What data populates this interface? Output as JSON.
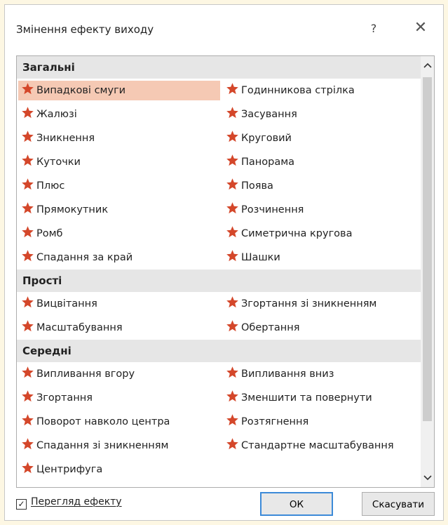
{
  "dialog": {
    "title": "Змінення ефекту виходу",
    "help_label": "?",
    "close_label": "✕"
  },
  "groups": [
    {
      "name": "Загальні",
      "rows": [
        [
          "Випадкові смуги",
          "Годинникова стрілка"
        ],
        [
          "Жалюзі",
          "Засування"
        ],
        [
          "Зникнення",
          "Круговий"
        ],
        [
          "Куточки",
          "Панорама"
        ],
        [
          "Плюс",
          "Поява"
        ],
        [
          "Прямокутник",
          "Розчинення"
        ],
        [
          "Ромб",
          "Симетрична кругова"
        ],
        [
          "Спадання за край",
          "Шашки"
        ]
      ]
    },
    {
      "name": "Прості",
      "rows": [
        [
          "Вицвітання",
          "Згортання зі зникненням"
        ],
        [
          "Масштабування",
          "Обертання"
        ]
      ]
    },
    {
      "name": "Середні",
      "rows": [
        [
          "Випливання вгору",
          "Випливання вниз"
        ],
        [
          "Згортання",
          "Зменшити та повернути"
        ],
        [
          "Поворот навколо центра",
          "Розтягнення"
        ],
        [
          "Спадання зі зникненням",
          "Стандартне масштабування"
        ],
        [
          "Центрифуга",
          ""
        ]
      ]
    }
  ],
  "selected_item": "Випадкові смуги",
  "preview": {
    "label": "Перегляд ефекту",
    "checked": true,
    "check_mark": "✓"
  },
  "buttons": {
    "ok": "ОК",
    "cancel": "Скасувати"
  },
  "scrollbar": {
    "up_glyph": "▲",
    "down_glyph": "▼"
  },
  "colors": {
    "star": "#d4472a",
    "selected_bg": "#f5c9b4"
  },
  "icons": {
    "effect": "red-star-icon"
  }
}
